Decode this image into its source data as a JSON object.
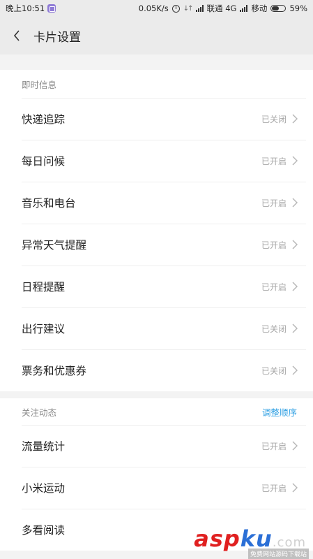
{
  "status_bar": {
    "time": "晚上10:51",
    "speed": "0.05K/s",
    "carrier1": "联通 4G",
    "carrier2": "移动",
    "battery": "59%",
    "battery_level": 0.59
  },
  "header": {
    "title": "卡片设置"
  },
  "sections": [
    {
      "title": "即时信息",
      "action": "",
      "items": [
        {
          "label": "快递追踪",
          "status": "已关闭"
        },
        {
          "label": "每日问候",
          "status": "已开启"
        },
        {
          "label": "音乐和电台",
          "status": "已开启"
        },
        {
          "label": "异常天气提醒",
          "status": "已开启"
        },
        {
          "label": "日程提醒",
          "status": "已开启"
        },
        {
          "label": "出行建议",
          "status": "已关闭"
        },
        {
          "label": "票务和优惠券",
          "status": "已关闭"
        }
      ]
    },
    {
      "title": "关注动态",
      "action": "调整顺序",
      "items": [
        {
          "label": "流量统计",
          "status": "已开启"
        },
        {
          "label": "小米运动",
          "status": "已开启"
        },
        {
          "label": "多看阅读",
          "status": ""
        }
      ]
    }
  ],
  "watermark": {
    "brand_a": "asp",
    "brand_b": "ku",
    "suffix": ".com",
    "sub": "免费网站源码下载站"
  },
  "colors": {
    "accent": "#2d9fe3",
    "header_bg": "#ebebeb",
    "status_text": "#a8a8a8"
  }
}
